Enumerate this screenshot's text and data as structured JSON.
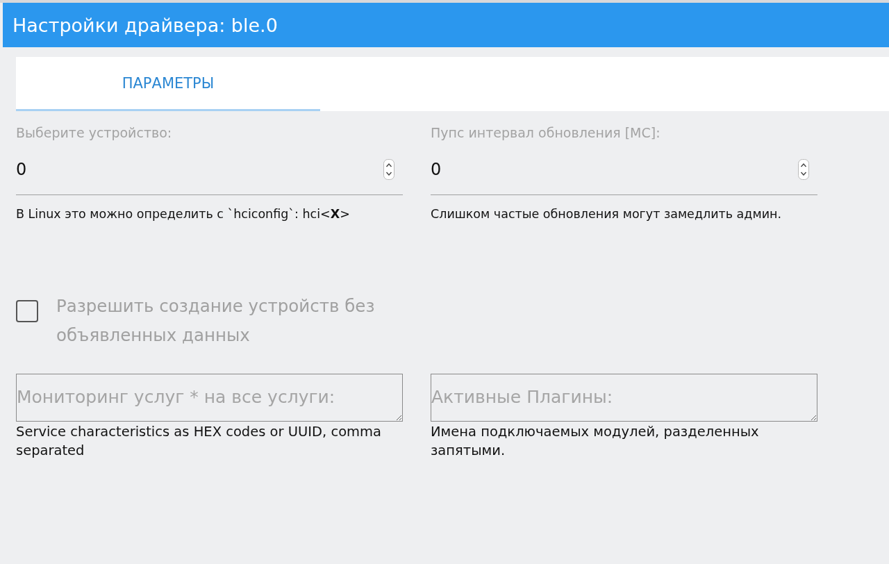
{
  "window": {
    "title": "Настройки драйвера: ble.0"
  },
  "tabs": [
    {
      "label": "ПАРАМЕТРЫ",
      "selected": true
    }
  ],
  "number_fields": [
    {
      "label": "Выберите устройство:",
      "value": "0",
      "hint": "В Linux это можно определить с `hciconfig`: hci<**X**>"
    },
    {
      "label": "Пупс интервал обновления [МС]:",
      "value": "0",
      "hint": "Слишком частые обновления могут замедлить админ."
    }
  ],
  "checkbox": {
    "label": "Разрешить создание устройств без объявленных данных",
    "checked": false
  },
  "text_areas": [
    {
      "placeholder": "Мониторинг услуг * на все услуги:",
      "hint": "Service characteristics as HEX codes or UUID, comma separated"
    },
    {
      "placeholder": "Активные Плагины:",
      "hint": "Имена подключаемых модулей, разделенных запятыми."
    }
  ]
}
